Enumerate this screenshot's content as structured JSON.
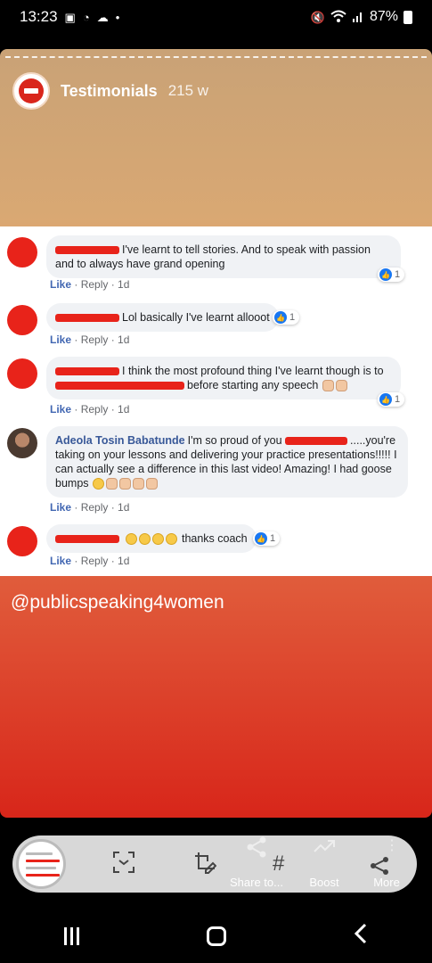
{
  "status_bar": {
    "time": "13:23",
    "battery": "87%",
    "left_icons": [
      "gallery-icon",
      "sync-icon",
      "cloud-icon",
      "dot-icon"
    ],
    "right_icons": [
      "mute-icon",
      "wifi-icon",
      "signal-icon",
      "battery-icon"
    ]
  },
  "story": {
    "account_name": "Testimonials",
    "age": "215 w",
    "handle": "@publicspeaking4women"
  },
  "comments": [
    {
      "text": "I've learnt to tell stories. And to speak with passion and to always have grand opening",
      "like": "Like",
      "reply": "Reply",
      "time": "1d",
      "reactions": "1"
    },
    {
      "text": "Lol basically I've learnt allooot",
      "like": "Like",
      "reply": "Reply",
      "time": "1d",
      "reactions": "1"
    },
    {
      "text_a": "I think the most profound thing I've learnt though is to",
      "text_b": "before starting any speech",
      "like": "Like",
      "reply": "Reply",
      "time": "1d",
      "reactions": "1"
    },
    {
      "name": "Adeola Tosin Babatunde",
      "text_a": "I'm so proud of you",
      "text_b": ".....you're taking on your lessons and delivering your practice presentations!!!!! I can actually see a difference in this last video! Amazing! I had goose bumps",
      "like": "Like",
      "reply": "Reply",
      "time": "1d"
    },
    {
      "text": "thanks coach",
      "like": "Like",
      "reply": "Reply",
      "time": "1d",
      "reactions": "1"
    }
  ],
  "toolbar": {
    "share_label": "Share to...",
    "boost_label": "Boost",
    "more_label": "More"
  }
}
